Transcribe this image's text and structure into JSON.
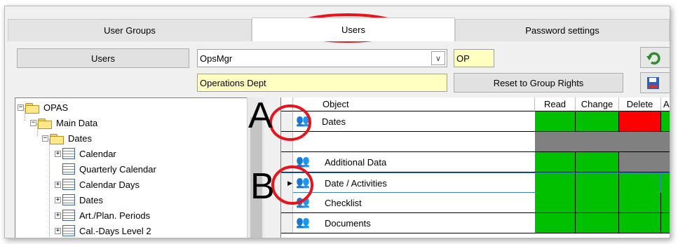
{
  "tabs": [
    {
      "label": "User Groups",
      "active": false
    },
    {
      "label": "Users",
      "active": true
    },
    {
      "label": "Password settings",
      "active": false
    }
  ],
  "toolbar": {
    "users_button": "Users",
    "user_value": "OpsMgr",
    "short_code": "OP",
    "group_name": "Operations Dept",
    "reset_button": "Reset to Group Rights",
    "refresh_icon": "refresh-icon",
    "save_icon": "save-icon"
  },
  "tree": {
    "items": [
      {
        "label": "OPAS",
        "kind": "folder",
        "expander": "−",
        "level": 0
      },
      {
        "label": "Main Data",
        "kind": "folder",
        "expander": "−",
        "level": 1
      },
      {
        "label": "Dates",
        "kind": "folder",
        "expander": "−",
        "level": 2
      },
      {
        "label": "Calendar",
        "kind": "table",
        "expander": "+",
        "level": 3
      },
      {
        "label": "Quarterly Calendar",
        "kind": "table",
        "expander": "",
        "level": 3
      },
      {
        "label": "Calendar Days",
        "kind": "table",
        "expander": "+",
        "level": 3
      },
      {
        "label": "Dates",
        "kind": "table",
        "expander": "+",
        "level": 3
      },
      {
        "label": "Art./Plan. Periods",
        "kind": "table",
        "expander": "+",
        "level": 3
      },
      {
        "label": "Cal.-Days Level 2",
        "kind": "table",
        "expander": "+",
        "level": 3
      }
    ]
  },
  "grid": {
    "columns": [
      "Object",
      "Read",
      "Change",
      "Delete",
      "App"
    ],
    "rows": [
      {
        "label": "Dates",
        "icon": "person-icon",
        "current": false,
        "cells": [
          "green",
          "green",
          "red",
          "green"
        ]
      },
      {
        "label": "",
        "icon": "",
        "current": false,
        "cells": [
          "gray",
          "gray",
          "gray",
          "gray"
        ]
      },
      {
        "label": "Additional Data",
        "icon": "person-icon",
        "current": false,
        "cells": [
          "green",
          "green",
          "gray",
          "gray"
        ]
      },
      {
        "label": "Date / Activities",
        "icon": "person-icon",
        "current": true,
        "cells": [
          "green",
          "green",
          "green",
          "green"
        ]
      },
      {
        "label": "Checklist",
        "icon": "person-icon",
        "current": false,
        "cells": [
          "green",
          "green",
          "green",
          "green"
        ]
      },
      {
        "label": "Documents",
        "icon": "person-icon",
        "current": false,
        "cells": [
          "green",
          "green",
          "green",
          "green"
        ]
      }
    ]
  },
  "annotations": {
    "letter_a": "A",
    "letter_b": "B",
    "circle_color": "#e8141c"
  },
  "colors": {
    "yellow_field": "#ffffc0",
    "green": "#00c000",
    "red": "#ff0000",
    "gray": "#808080"
  }
}
